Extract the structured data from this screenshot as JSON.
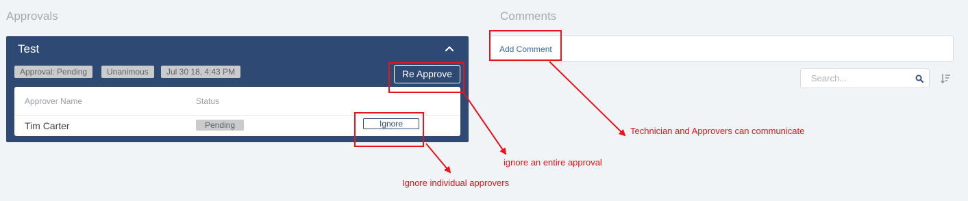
{
  "approvals": {
    "title": "Approvals",
    "card": {
      "title": "Test",
      "tags": [
        "Approval: Pending",
        "Unanimous",
        "Jul 30 18, 4:43 PM"
      ],
      "reapprove_label": "Re Approve",
      "table": {
        "headers": [
          "Approver Name",
          "Status"
        ],
        "rows": [
          {
            "name": "Tim Carter",
            "status": "Pending",
            "action_label": "Ignore"
          }
        ]
      }
    }
  },
  "comments": {
    "title": "Comments",
    "add_comment_label": "Add Comment",
    "search_placeholder": "Search..."
  },
  "annotations": {
    "communicate": "Technician and Approvers can communicate",
    "entire_approval": "ignore an entire approval",
    "individual": "Ignore individual approvers"
  },
  "colors": {
    "card_background": "#2e4a74",
    "annotation_red": "#e8131c",
    "link_blue": "#3d66b0"
  }
}
